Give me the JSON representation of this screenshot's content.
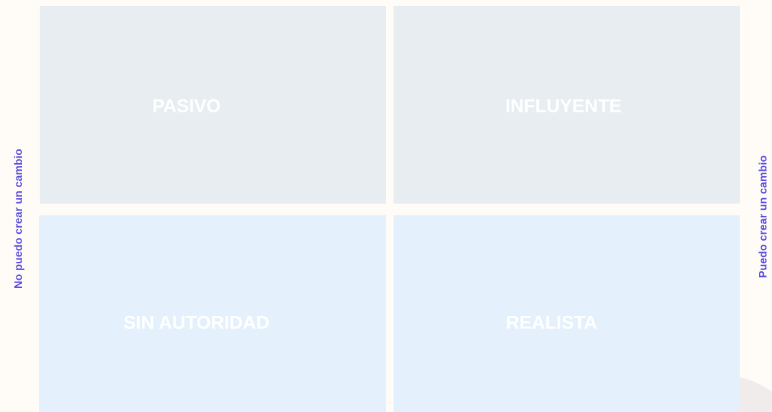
{
  "axes": {
    "left_label": "No puedo crear un cambio",
    "right_label": "Puedo crear un cambio"
  },
  "quadrants": {
    "top_left": "PASIVO",
    "top_right": "INFLUYENTE",
    "bottom_left": "SIN AUTORIDAD",
    "bottom_right": "REALISTA"
  },
  "colors": {
    "background": "#fffcf7",
    "axis_text": "#5b4fe0",
    "top_quadrant": "#e7edf1",
    "bottom_quadrant": "#e4f1fc",
    "quadrant_text": "#ffffff",
    "decorative_arc": "#efeceb"
  }
}
